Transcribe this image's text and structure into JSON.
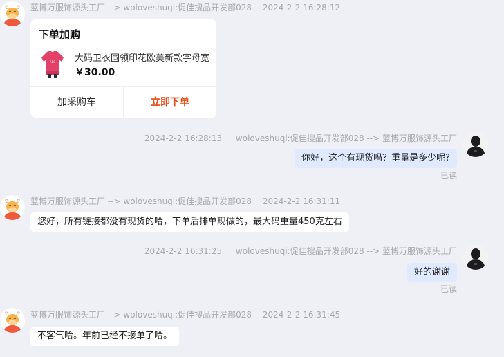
{
  "messages": [
    {
      "sender": "蓝博万服饰源头工厂",
      "arrow": "-->",
      "receiver": "woloveshuqi:促佳搜品开发部028",
      "time": "2024-2-2 16:28:12",
      "card": {
        "title": "下单加购",
        "product_name": "大码卫衣圆领印花欧美新款字母宽",
        "price": "￥30.00",
        "add_cart_label": "加采购车",
        "order_now_label": "立即下单"
      }
    },
    {
      "sender": "woloveshuqi:促佳搜品开发部028",
      "arrow": "-->",
      "receiver": "蓝博万服饰源头工厂",
      "time": "2024-2-2 16:28:13",
      "text": "你好，这个有现货吗？重量是多少呢?",
      "status": "已读"
    },
    {
      "sender": "蓝博万服饰源头工厂",
      "arrow": "-->",
      "receiver": "woloveshuqi:促佳搜品开发部028",
      "time": "2024-2-2 16:31:11",
      "text": "您好，所有链接都没有现货的哈，下单后排单现做的，最大码重量450克左右"
    },
    {
      "sender": "woloveshuqi:促佳搜品开发部028",
      "arrow": "-->",
      "receiver": "蓝博万服饰源头工厂",
      "time": "2024-2-2 16:31:25",
      "text": "好的谢谢",
      "status": "已读"
    },
    {
      "sender": "蓝博万服饰源头工厂",
      "arrow": "-->",
      "receiver": "woloveshuqi:促佳搜品开发部028",
      "time": "2024-2-2 16:31:45",
      "text": "不客气哈。年前已经不接单了哈。"
    }
  ],
  "colors": {
    "background": "#eff0f5",
    "outgoing_bubble": "#dfeaff",
    "incoming_bubble": "#ffffff",
    "accent": "#e8470f",
    "meta_text": "#a6a8ae"
  },
  "icons": {
    "seller_avatar": "cartoon-cow-avatar-icon",
    "buyer_avatar": "person-black-hoodie-avatar-icon",
    "product_thumb": "pink-sweatshirt-icon"
  }
}
